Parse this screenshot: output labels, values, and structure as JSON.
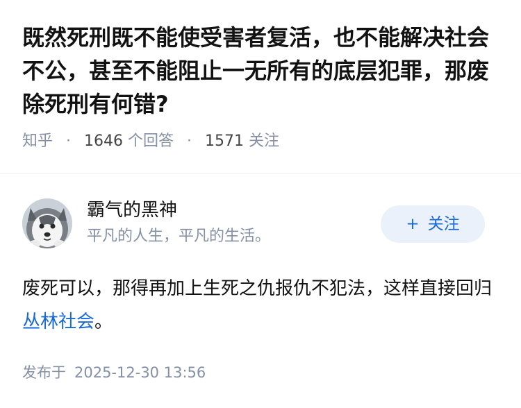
{
  "question": {
    "title": "既然死刑既不能使受害者复活，也不能解决社会不公，甚至不能阻止一无所有的底层犯罪，那废除死刑有何错?",
    "source": "知乎",
    "answer_count_value": "1646",
    "answer_count_label": "个回答",
    "follower_count_value": "1571",
    "follower_label": "关注"
  },
  "answer": {
    "author": {
      "name": "霸气的黑神",
      "bio": "平凡的人生，平凡的生活。",
      "avatar_icon": "husky-dog-avatar"
    },
    "follow_button": {
      "plus": "+",
      "label": "关注"
    },
    "content_before_link": "废死可以，那得再加上生死之仇报仇不犯法，这样直接回归",
    "content_link": "丛林社会",
    "content_after_link": "。",
    "published_label": "发布于",
    "published_time": "2025-12-30 13:56"
  },
  "colors": {
    "accent": "#1769d6",
    "meta": "#8590a6",
    "button_bg": "#eaf1fb",
    "text": "#121212"
  }
}
